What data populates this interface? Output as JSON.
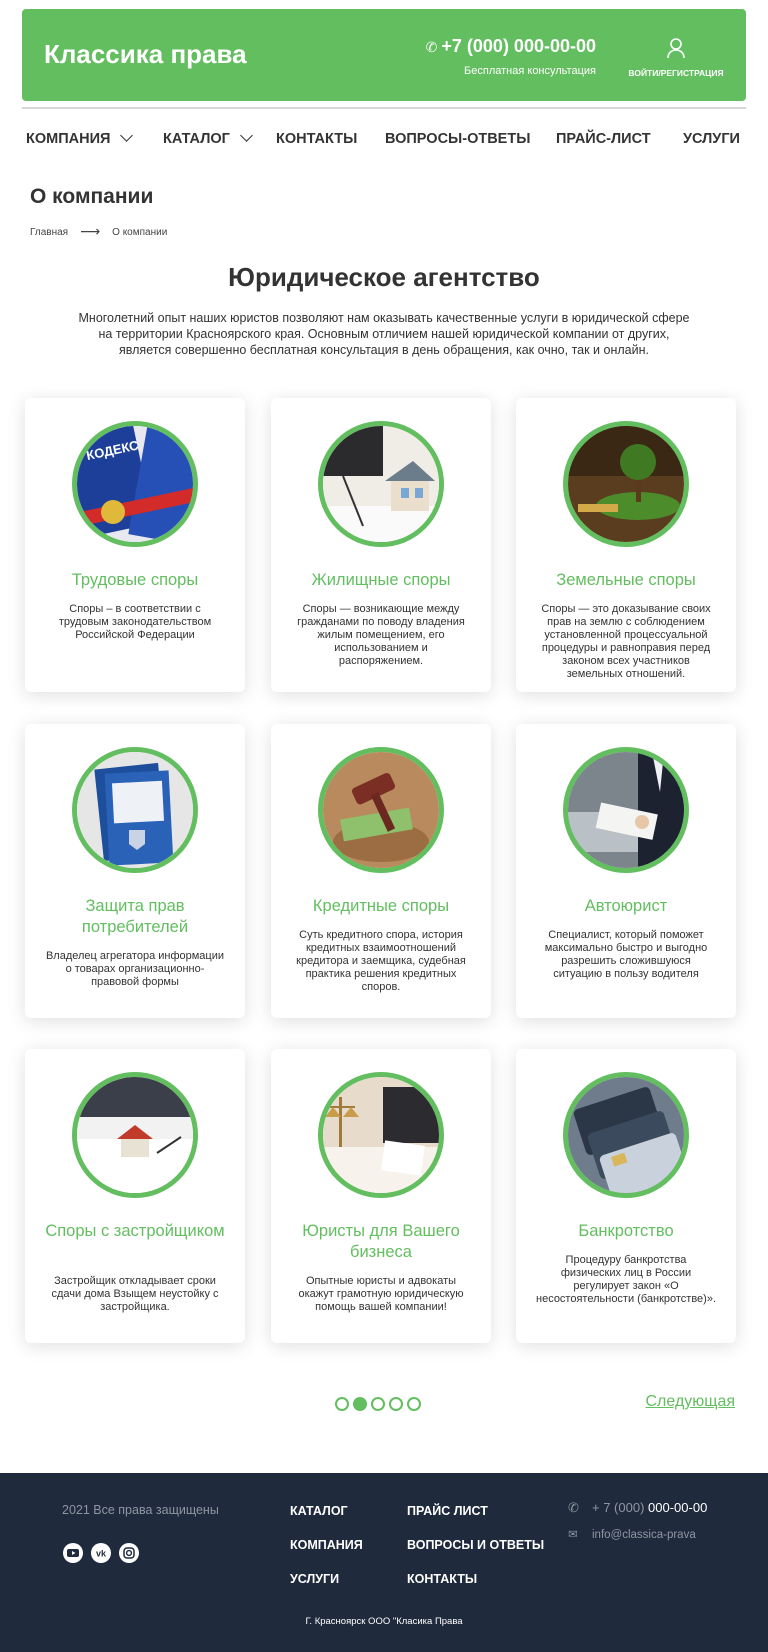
{
  "header": {
    "logo": "Классика права",
    "phone": "+7 (000) 000-00-00",
    "consultation": "Бесплатная консультация",
    "login": "ВОЙТИ/РЕГИСТРАЦИЯ",
    "brand_color": "#62be5f"
  },
  "nav": {
    "items": [
      {
        "label": "КОМПАНИЯ",
        "dropdown": true
      },
      {
        "label": "КАТАЛОГ",
        "dropdown": true
      },
      {
        "label": "КОНТАКТЫ",
        "dropdown": false
      },
      {
        "label": "ВОПРОСЫ-ОТВЕТЫ",
        "dropdown": false
      },
      {
        "label": "ПРАЙС-ЛИСТ",
        "dropdown": false
      },
      {
        "label": "УСЛУГИ",
        "dropdown": false
      }
    ]
  },
  "page": {
    "title": "О компании",
    "breadcrumb": [
      "Главная",
      "О компании"
    ]
  },
  "main": {
    "heading": "Юридическое агентство",
    "intro_lines": [
      "Многолетний опыт наших юристов позволяют нам оказывать качественные услуги в юридической сфере",
      "на территории Красноярского края. Основным отличием нашей юридической компании от других,",
      "является совершенно бесплатная консультация в день обращения, как очно, так и онлайн."
    ]
  },
  "cards": [
    {
      "title": "Трудовые споры",
      "desc": "Споры – в соответствии с трудовым законодательством Российской Федерации"
    },
    {
      "title": "Жилищные споры",
      "desc": "Споры — возникающие между гражданами по поводу владения жилым помещением, его использованием и распоряжением."
    },
    {
      "title": "Земельные споры",
      "desc": "Споры — это доказывание своих прав на землю с соблюдением установленной процессуальной процедуры и равноправия перед законом всех участников земельных отношений."
    },
    {
      "title": "Защита прав потребителей",
      "desc": "Владелец агрегатора информации о товарах организационно-правовой формы"
    },
    {
      "title": "Кредитные споры",
      "desc": "Суть кредитного спора, история кредитных взаимоотношений кредитора и заемщика, судебная практика решения кредитных споров."
    },
    {
      "title": "Автоюрист",
      "desc": "Специалист, который поможет максимально быстро и выгодно разрешить сложившуюся ситуацию в пользу водителя"
    },
    {
      "title": "Споры с застройщиком",
      "desc": "Застройщик откладывает сроки сдачи дома Взыщем неустойку с застройщика."
    },
    {
      "title": "Юристы для Вашего бизнеса",
      "desc": "Опытные юристы и адвокаты окажут грамотную юридическую помощь вашей компании!"
    },
    {
      "title": "Банкротство",
      "desc": "Процедуру банкротства физических лиц в России регулирует закон «О несостоятельности (банкротстве)»."
    }
  ],
  "pagination": {
    "pages": 5,
    "active_page": 2,
    "next_label": "Следующая"
  },
  "footer": {
    "copyright": "2021 Все права защищены",
    "social": [
      "youtube-icon",
      "vk-icon",
      "instagram-icon"
    ],
    "links_col1": [
      "КАТАЛОГ",
      "КОМПАНИЯ",
      "УСЛУГИ"
    ],
    "links_col2": [
      "ПРАЙС ЛИСТ",
      "ВОПРОСЫ И ОТВЕТЫ",
      "КОНТАКТЫ"
    ],
    "phone_prefix": "+ 7 (000)",
    "phone_number": "000-00-00",
    "email": "info@classica-prava",
    "address": "Г. Красноярск  ООО \"Класика Права"
  }
}
